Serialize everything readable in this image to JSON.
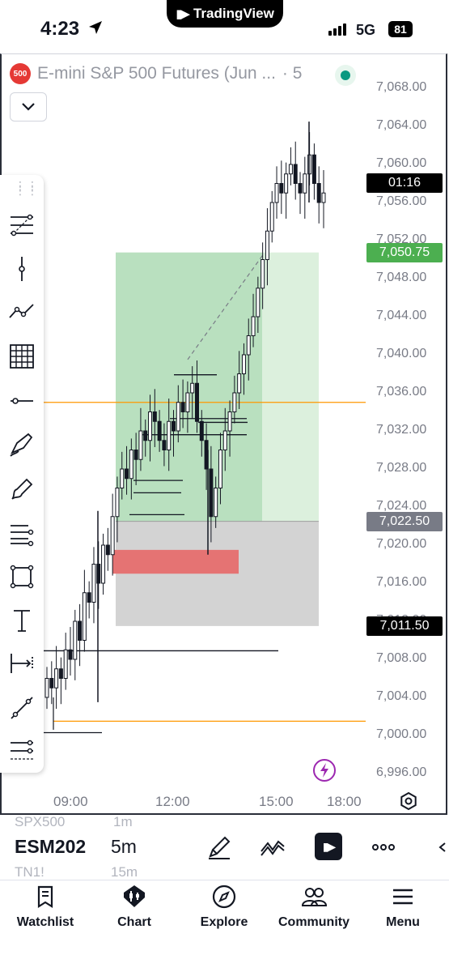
{
  "status_bar": {
    "time": "4:23",
    "carrier_badge": "TradingView",
    "network": "5G",
    "battery": "81",
    "icons": [
      "location-arrow-icon",
      "signal-bars-icon",
      "battery-icon"
    ]
  },
  "chart_header": {
    "symbol_badge": "500",
    "title": "E-mini S&P 500 Futures (Jun ...",
    "interval": "· 5",
    "market_status_color": "#089981"
  },
  "price_labels": {
    "countdown": "01:16",
    "take_profit": "7,050.75",
    "entry": "7,022.50",
    "current": "7,011.50",
    "colors": {
      "countdown": "#000000",
      "take_profit": "#4caf50",
      "entry": "#787b86",
      "current": "#000000"
    }
  },
  "chart_data": {
    "type": "candlestick",
    "symbol": "ESM2026",
    "interval": "5m",
    "price_axis_ticks": [
      "7,068.00",
      "7,064.00",
      "7,060.00",
      "7,056.00",
      "7,052.00",
      "7,048.00",
      "7,044.00",
      "7,040.00",
      "7,036.00",
      "7,032.00",
      "7,028.00",
      "7,024.00",
      "7,020.00",
      "7,016.00",
      "7,012.00",
      "7,008.00",
      "7,004.00",
      "7,000.00",
      "6,996.00"
    ],
    "time_axis_ticks": [
      "09:00",
      "12:00",
      "15:00",
      "18:00"
    ],
    "ylim": [
      6994.5,
      7069.5
    ],
    "current_price": 7011.5,
    "horizontal_lines": [
      {
        "price": 7035.0,
        "color": "#ff9800"
      },
      {
        "price": 7001.5,
        "color": "#ff9800"
      }
    ],
    "long_position": {
      "entry": 7022.5,
      "target": 7050.75,
      "stop": 7011.5,
      "profit_color": "#4caf50",
      "stop_color": "#9e9e9e"
    },
    "zone": {
      "price_high": 7019.5,
      "price_low": 7017.0,
      "color": "#e57373"
    },
    "candles_approx_close": [
      7006,
      7005,
      7007,
      7006,
      7009,
      7008,
      7012,
      7010,
      7015,
      7014,
      7018,
      7016,
      7020,
      7019,
      7023,
      7026,
      7028,
      7027,
      7030,
      7029,
      7032,
      7031,
      7034,
      7033,
      7031,
      7030,
      7033,
      7032,
      7035,
      7034,
      7036,
      7037,
      7033,
      7031,
      7028,
      7023,
      7026,
      7030,
      7032,
      7034,
      7036,
      7038,
      7040,
      7042,
      7044,
      7047,
      7050,
      7053,
      7056,
      7058,
      7057,
      7059,
      7060,
      7058,
      7057,
      7059,
      7061,
      7058,
      7056,
      7057
    ]
  },
  "drawing_tools": [
    {
      "name": "fib-retracement-icon"
    },
    {
      "name": "vertical-line-icon"
    },
    {
      "name": "trend-line-icon"
    },
    {
      "name": "gann-grid-icon"
    },
    {
      "name": "horizontal-ray-icon"
    },
    {
      "name": "brush-icon"
    },
    {
      "name": "highlighter-icon"
    },
    {
      "name": "parallel-channel-icon"
    },
    {
      "name": "rectangle-icon"
    },
    {
      "name": "text-icon"
    },
    {
      "name": "measure-icon"
    },
    {
      "name": "ray-icon"
    },
    {
      "name": "fib-channel-icon"
    }
  ],
  "symbol_strip": {
    "prev_symbol": "SPX500",
    "prev_interval": "1m",
    "current_symbol": "ESM202",
    "current_interval": "5m",
    "next_symbol": "TN1!",
    "next_interval": "15m"
  },
  "bottom_nav": [
    {
      "label": "Watchlist",
      "icon": "watchlist-icon"
    },
    {
      "label": "Chart",
      "icon": "chart-icon"
    },
    {
      "label": "Explore",
      "icon": "compass-icon"
    },
    {
      "label": "Community",
      "icon": "community-icon"
    },
    {
      "label": "Menu",
      "icon": "menu-icon"
    }
  ]
}
